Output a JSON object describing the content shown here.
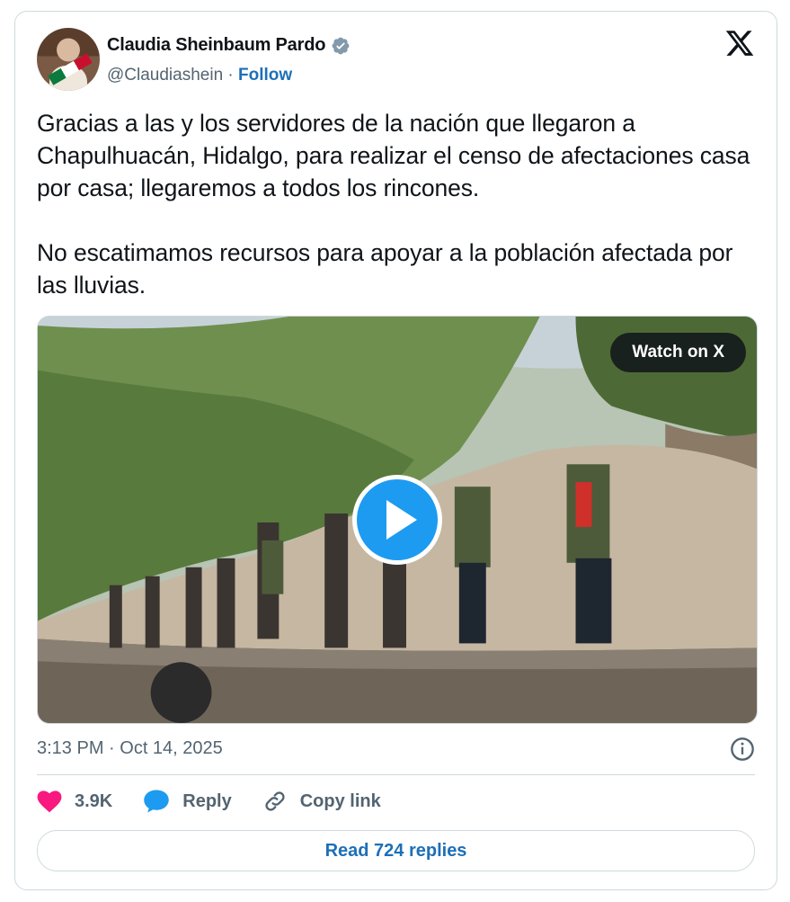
{
  "author": {
    "name": "Claudia Sheinbaum Pardo",
    "handle": "@Claudiashein",
    "separator": "·",
    "follow_label": "Follow"
  },
  "post": {
    "paragraphs": [
      "Gracias a las y los servidores de la nación que llegaron a Chapulhuacán, Hidalgo, para realizar el censo de afectaciones casa por casa; llegaremos a todos los rincones.",
      "No escatimamos recursos para apoyar a la población afectada por las lluvias."
    ],
    "timestamp": "3:13 PM · Oct 14, 2025"
  },
  "media": {
    "watch_label": "Watch on X",
    "type": "video"
  },
  "actions": {
    "likes": "3.9K",
    "reply_label": "Reply",
    "copy_link_label": "Copy link"
  },
  "read_replies_label": "Read 724 replies",
  "colors": {
    "accent": "#1d9bf0",
    "link": "#1d6fb8",
    "like": "#f91880",
    "muted": "#536471"
  },
  "icons": [
    "verified-badge-icon",
    "x-logo-icon",
    "play-icon",
    "info-icon",
    "heart-icon",
    "reply-bubble-icon",
    "link-icon"
  ]
}
